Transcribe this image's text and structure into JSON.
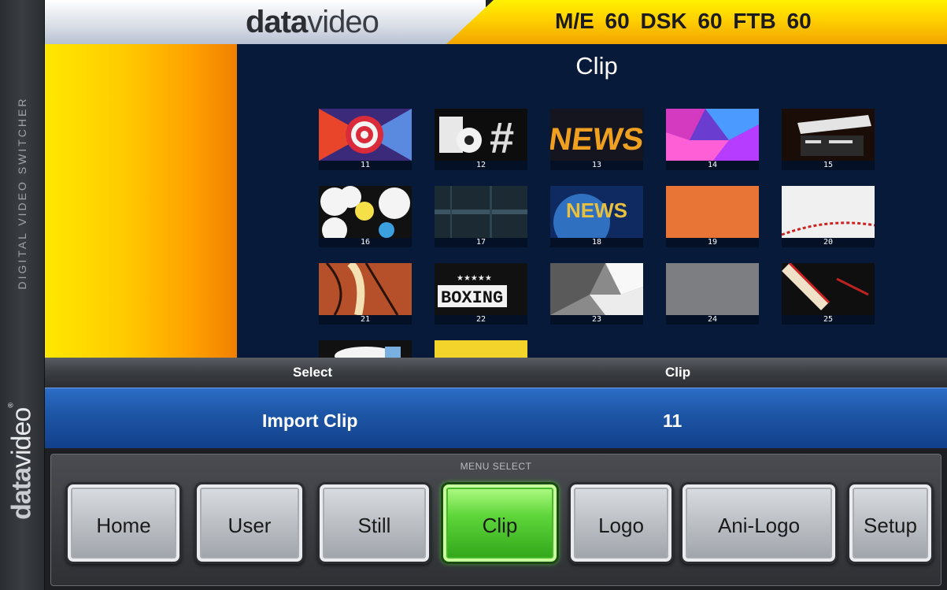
{
  "side": {
    "label": "DIGITAL VIDEO SWITCHER",
    "logo_bold": "data",
    "logo_light": "video",
    "logo_mark": "®"
  },
  "header": {
    "brand_bold": "data",
    "brand_light": "video",
    "status": "M/E 60  DSK 60  FTB 60"
  },
  "main": {
    "title": "Clip",
    "clips": [
      {
        "num": "11",
        "icon": "target-ring-icon"
      },
      {
        "num": "12",
        "icon": "soccer-hash-icon"
      },
      {
        "num": "13",
        "icon": "news-text-icon"
      },
      {
        "num": "14",
        "icon": "color-blocks-icon"
      },
      {
        "num": "15",
        "icon": "clapperboard-icon"
      },
      {
        "num": "16",
        "icon": "weather-icon"
      },
      {
        "num": "17",
        "icon": "dark-texture-icon"
      },
      {
        "num": "18",
        "icon": "news-globe-icon"
      },
      {
        "num": "19",
        "icon": "basketball-texture-icon"
      },
      {
        "num": "20",
        "icon": "baseball-icon"
      },
      {
        "num": "21",
        "icon": "basketball-icon"
      },
      {
        "num": "22",
        "icon": "boxing-icon"
      },
      {
        "num": "23",
        "icon": "soccer-ball-icon"
      },
      {
        "num": "24",
        "icon": "gray-texture-icon"
      },
      {
        "num": "25",
        "icon": "darts-icon"
      },
      {
        "num": "",
        "icon": "partial-clip-icon"
      },
      {
        "num": "",
        "icon": "partial-yellow-clip-icon"
      }
    ]
  },
  "info": {
    "select_header": "Select",
    "clip_header": "Clip",
    "select_value": "Import Clip",
    "clip_value": "11"
  },
  "menu": {
    "caption": "MENU SELECT",
    "buttons": [
      "Home",
      "User",
      "Still",
      "Clip",
      "Logo",
      "Ani-Logo",
      "Setup"
    ],
    "active": "Clip"
  }
}
